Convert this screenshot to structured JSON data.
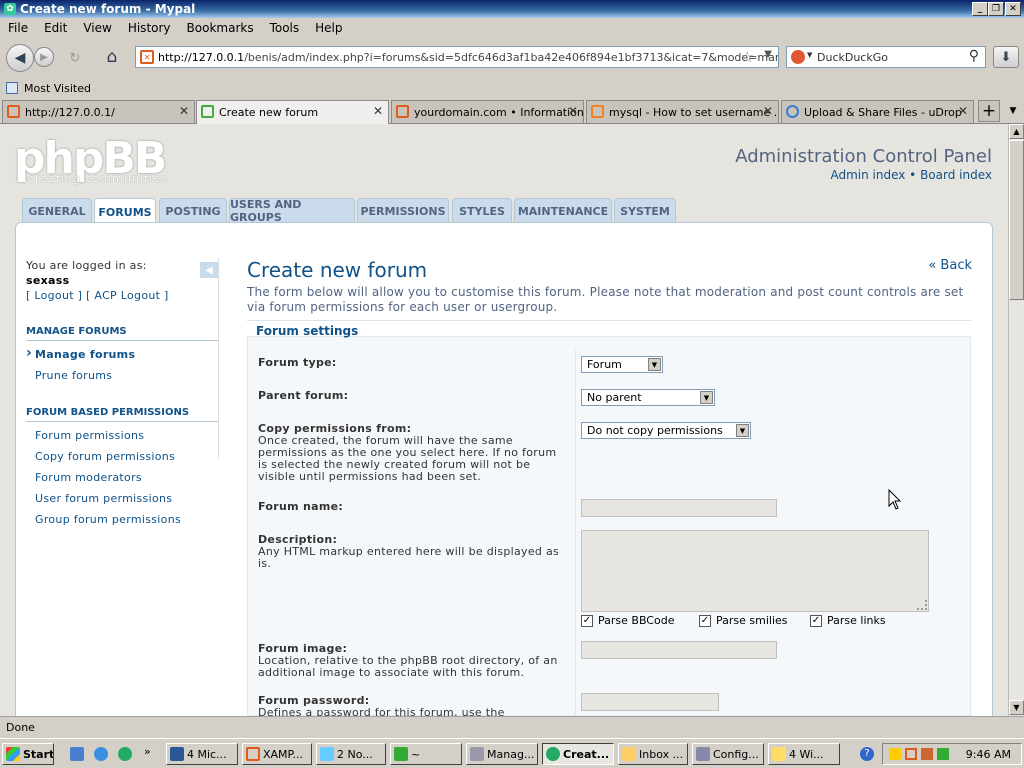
{
  "window": {
    "title": "Create new forum - Mypal"
  },
  "menubar": [
    "File",
    "Edit",
    "View",
    "History",
    "Bookmarks",
    "Tools",
    "Help"
  ],
  "url": {
    "host": "http://127.0.0.1",
    "path": "/benis/adm/index.php?i=forums&sid=5dfc646d3af1ba42e406f894e1bf3713&icat=7&mode=manage&p..."
  },
  "search": {
    "placeholder": "DuckDuckGo"
  },
  "bookmarks": {
    "most_visited": "Most Visited"
  },
  "tabs": [
    {
      "label": "http://127.0.0.1/"
    },
    {
      "label": "Create new forum"
    },
    {
      "label": "yourdomain.com • Information"
    },
    {
      "label": "mysql - How to set username ..."
    },
    {
      "label": "Upload & Share Files - uDrop"
    }
  ],
  "status": "Done",
  "taskbar": {
    "start": "Start",
    "items": [
      "4 Mic...",
      "XAMP...",
      "2 No...",
      "~",
      "Manag...",
      "Creat...",
      "Inbox ...",
      "Config...",
      "4 Wi..."
    ],
    "clock": "9:46 AM"
  },
  "phpbb": {
    "logo": "phpBB",
    "logo_sub": "creating communities",
    "acp_title": "Administration Control Panel",
    "admin_index": "Admin index",
    "sep": "•",
    "board_index": "Board index",
    "nav_tabs": [
      "GENERAL",
      "FORUMS",
      "POSTING",
      "USERS AND GROUPS",
      "PERMISSIONS",
      "STYLES",
      "MAINTENANCE",
      "SYSTEM"
    ],
    "logged_in_as": "You are logged in as:",
    "username": "sexass",
    "logout": "[ Logout ]",
    "acp_logout": "[ ACP Logout ]",
    "menu": {
      "manage_head": "MANAGE FORUMS",
      "manage_forums": "Manage forums",
      "prune_forums": "Prune forums",
      "perm_head": "FORUM BASED PERMISSIONS",
      "forum_permissions": "Forum permissions",
      "copy_forum_permissions": "Copy forum permissions",
      "forum_moderators": "Forum moderators",
      "user_forum_permissions": "User forum permissions",
      "group_forum_permissions": "Group forum permissions"
    },
    "page_title": "Create new forum",
    "back": "« Back",
    "intro": "The form below will allow you to customise this forum. Please note that moderation and post count controls are set via forum permissions for each user or usergroup.",
    "legend": "Forum settings",
    "fields": {
      "forum_type_label": "Forum type:",
      "forum_type_value": "Forum",
      "parent_label": "Parent forum:",
      "parent_value": "No parent",
      "copy_label": "Copy permissions from:",
      "copy_desc": "Once created, the forum will have the same permissions as the one you select here. If no forum is selected the newly created forum will not be visible until permissions had been set.",
      "copy_value": "Do not copy permissions",
      "name_label": "Forum name:",
      "desc_label": "Description:",
      "desc_desc": "Any HTML markup entered here will be displayed as is.",
      "parse_bbcode": "Parse BBCode",
      "parse_smilies": "Parse smilies",
      "parse_links": "Parse links",
      "image_label": "Forum image:",
      "image_desc": "Location, relative to the phpBB root directory, of an additional image to associate with this forum.",
      "password_label": "Forum password:",
      "password_desc": "Defines a password for this forum, use the permission"
    }
  },
  "colors": {
    "link": "#105289",
    "tab_bg": "#cadceb",
    "heading": "#536482"
  }
}
